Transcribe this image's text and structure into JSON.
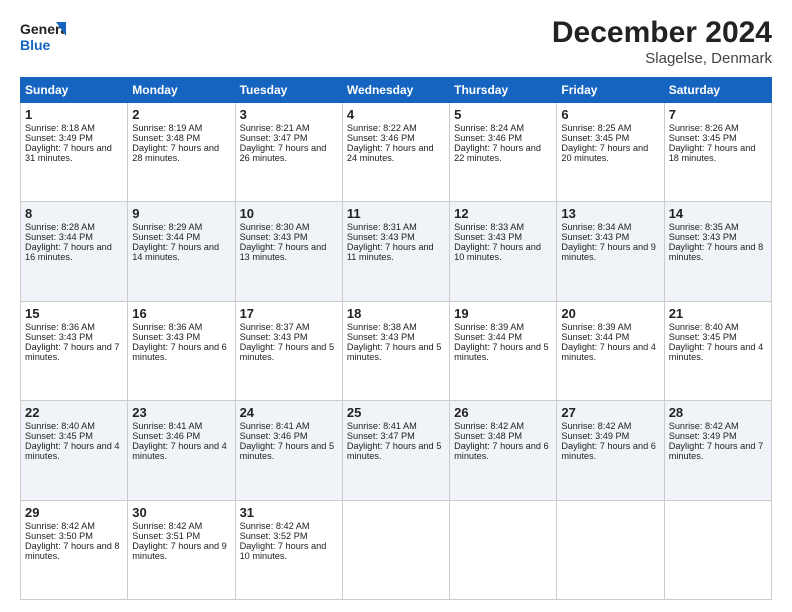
{
  "header": {
    "logo_line1": "General",
    "logo_line2": "Blue",
    "month": "December 2024",
    "location": "Slagelse, Denmark"
  },
  "days": [
    "Sunday",
    "Monday",
    "Tuesday",
    "Wednesday",
    "Thursday",
    "Friday",
    "Saturday"
  ],
  "weeks": [
    [
      {
        "day": 1,
        "sunrise": "8:18 AM",
        "sunset": "3:49 PM",
        "daylight": "7 hours and 31 minutes."
      },
      {
        "day": 2,
        "sunrise": "8:19 AM",
        "sunset": "3:48 PM",
        "daylight": "7 hours and 28 minutes."
      },
      {
        "day": 3,
        "sunrise": "8:21 AM",
        "sunset": "3:47 PM",
        "daylight": "7 hours and 26 minutes."
      },
      {
        "day": 4,
        "sunrise": "8:22 AM",
        "sunset": "3:46 PM",
        "daylight": "7 hours and 24 minutes."
      },
      {
        "day": 5,
        "sunrise": "8:24 AM",
        "sunset": "3:46 PM",
        "daylight": "7 hours and 22 minutes."
      },
      {
        "day": 6,
        "sunrise": "8:25 AM",
        "sunset": "3:45 PM",
        "daylight": "7 hours and 20 minutes."
      },
      {
        "day": 7,
        "sunrise": "8:26 AM",
        "sunset": "3:45 PM",
        "daylight": "7 hours and 18 minutes."
      }
    ],
    [
      {
        "day": 8,
        "sunrise": "8:28 AM",
        "sunset": "3:44 PM",
        "daylight": "7 hours and 16 minutes."
      },
      {
        "day": 9,
        "sunrise": "8:29 AM",
        "sunset": "3:44 PM",
        "daylight": "7 hours and 14 minutes."
      },
      {
        "day": 10,
        "sunrise": "8:30 AM",
        "sunset": "3:43 PM",
        "daylight": "7 hours and 13 minutes."
      },
      {
        "day": 11,
        "sunrise": "8:31 AM",
        "sunset": "3:43 PM",
        "daylight": "7 hours and 11 minutes."
      },
      {
        "day": 12,
        "sunrise": "8:33 AM",
        "sunset": "3:43 PM",
        "daylight": "7 hours and 10 minutes."
      },
      {
        "day": 13,
        "sunrise": "8:34 AM",
        "sunset": "3:43 PM",
        "daylight": "7 hours and 9 minutes."
      },
      {
        "day": 14,
        "sunrise": "8:35 AM",
        "sunset": "3:43 PM",
        "daylight": "7 hours and 8 minutes."
      }
    ],
    [
      {
        "day": 15,
        "sunrise": "8:36 AM",
        "sunset": "3:43 PM",
        "daylight": "7 hours and 7 minutes."
      },
      {
        "day": 16,
        "sunrise": "8:36 AM",
        "sunset": "3:43 PM",
        "daylight": "7 hours and 6 minutes."
      },
      {
        "day": 17,
        "sunrise": "8:37 AM",
        "sunset": "3:43 PM",
        "daylight": "7 hours and 5 minutes."
      },
      {
        "day": 18,
        "sunrise": "8:38 AM",
        "sunset": "3:43 PM",
        "daylight": "7 hours and 5 minutes."
      },
      {
        "day": 19,
        "sunrise": "8:39 AM",
        "sunset": "3:44 PM",
        "daylight": "7 hours and 5 minutes."
      },
      {
        "day": 20,
        "sunrise": "8:39 AM",
        "sunset": "3:44 PM",
        "daylight": "7 hours and 4 minutes."
      },
      {
        "day": 21,
        "sunrise": "8:40 AM",
        "sunset": "3:45 PM",
        "daylight": "7 hours and 4 minutes."
      }
    ],
    [
      {
        "day": 22,
        "sunrise": "8:40 AM",
        "sunset": "3:45 PM",
        "daylight": "7 hours and 4 minutes."
      },
      {
        "day": 23,
        "sunrise": "8:41 AM",
        "sunset": "3:46 PM",
        "daylight": "7 hours and 4 minutes."
      },
      {
        "day": 24,
        "sunrise": "8:41 AM",
        "sunset": "3:46 PM",
        "daylight": "7 hours and 5 minutes."
      },
      {
        "day": 25,
        "sunrise": "8:41 AM",
        "sunset": "3:47 PM",
        "daylight": "7 hours and 5 minutes."
      },
      {
        "day": 26,
        "sunrise": "8:42 AM",
        "sunset": "3:48 PM",
        "daylight": "7 hours and 6 minutes."
      },
      {
        "day": 27,
        "sunrise": "8:42 AM",
        "sunset": "3:49 PM",
        "daylight": "7 hours and 6 minutes."
      },
      {
        "day": 28,
        "sunrise": "8:42 AM",
        "sunset": "3:49 PM",
        "daylight": "7 hours and 7 minutes."
      }
    ],
    [
      {
        "day": 29,
        "sunrise": "8:42 AM",
        "sunset": "3:50 PM",
        "daylight": "7 hours and 8 minutes."
      },
      {
        "day": 30,
        "sunrise": "8:42 AM",
        "sunset": "3:51 PM",
        "daylight": "7 hours and 9 minutes."
      },
      {
        "day": 31,
        "sunrise": "8:42 AM",
        "sunset": "3:52 PM",
        "daylight": "7 hours and 10 minutes."
      },
      null,
      null,
      null,
      null
    ]
  ],
  "labels": {
    "sunrise": "Sunrise:",
    "sunset": "Sunset:",
    "daylight": "Daylight:"
  }
}
